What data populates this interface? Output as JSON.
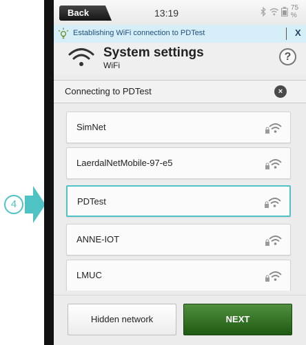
{
  "statusbar": {
    "back_label": "Back",
    "time": "13:19",
    "battery": "75 %"
  },
  "notification": {
    "text": "Establishing WiFi connection to PDTest",
    "close": "X"
  },
  "header": {
    "title": "System settings",
    "subtitle": "WiFi",
    "help": "?"
  },
  "connecting": {
    "text": "Connecting to PDTest",
    "cancel": "×"
  },
  "networks": [
    {
      "name": "SimNet",
      "secured": true,
      "selected": false
    },
    {
      "name": "LaerdalNetMobile-97-e5",
      "secured": true,
      "selected": false
    },
    {
      "name": "PDTest",
      "secured": true,
      "selected": true
    },
    {
      "name": "ANNE-IOT",
      "secured": true,
      "selected": false
    },
    {
      "name": "LMUC",
      "secured": true,
      "selected": false
    }
  ],
  "footer": {
    "hidden_label": "Hidden network",
    "next_label": "NEXT"
  },
  "callout": {
    "step": "4",
    "color": "#4fc2c3"
  },
  "colors": {
    "accent": "#4fc2c3",
    "next_green": "#2f6e20",
    "notification_bg": "#d6eef8"
  }
}
